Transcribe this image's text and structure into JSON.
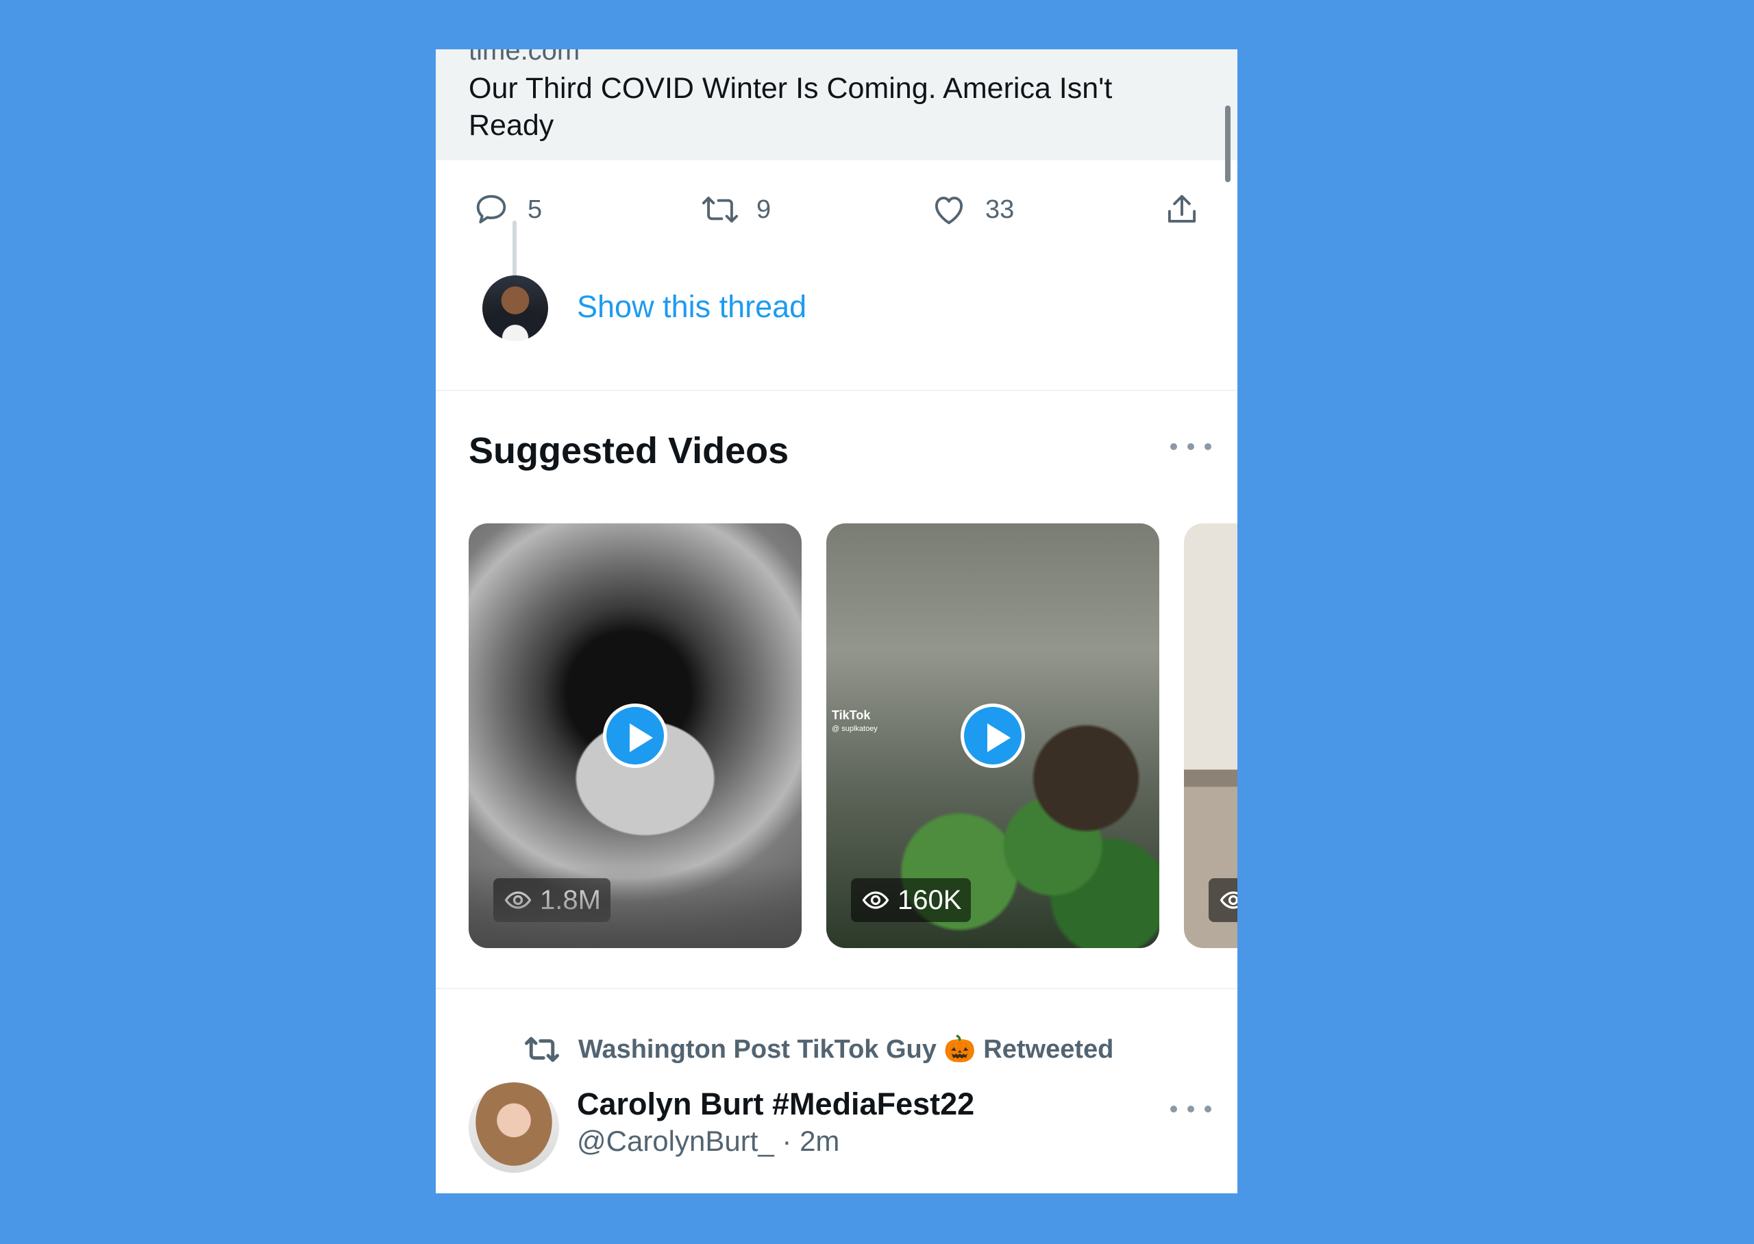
{
  "link_card": {
    "domain": "time.com",
    "title": "Our Third COVID Winter Is Coming. America Isn't Ready"
  },
  "actions": {
    "reply_count": "5",
    "retweet_count": "9",
    "like_count": "33"
  },
  "thread": {
    "show_label": "Show this thread"
  },
  "suggested": {
    "title": "Suggested Videos",
    "videos": [
      {
        "views": "1.8M"
      },
      {
        "views": "160K",
        "watermark": "TikTok",
        "handle": "@ suplkatoey"
      },
      {
        "views": ""
      }
    ]
  },
  "next_tweet": {
    "retweeted_by": "Washington Post TikTok Guy 🎃 Retweeted",
    "author_name": "Carolyn Burt #MediaFest22",
    "handle_time": "@CarolynBurt_ · 2m"
  },
  "colors": {
    "background": "#4a97e8",
    "accent": "#1d9bf0",
    "secondary_text": "#536471"
  },
  "icons": [
    "reply-icon",
    "retweet-icon",
    "like-icon",
    "share-icon",
    "play-icon",
    "eye-icon",
    "more-icon"
  ]
}
